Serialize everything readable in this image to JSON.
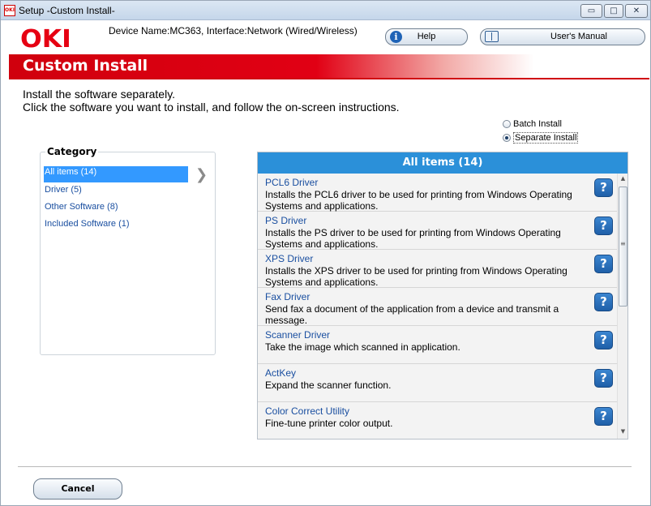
{
  "window": {
    "title": "Setup -Custom Install-",
    "icon_text": "OKI",
    "controls": {
      "minimize": "▭",
      "maximize": "□",
      "close": "✕"
    }
  },
  "header": {
    "logo": "OKI",
    "device_info": "Device Name:MC363, Interface:Network (Wired/Wireless)",
    "help_label": "Help",
    "manual_label": "User's Manual"
  },
  "banner": {
    "title": "Custom Install"
  },
  "instructions": {
    "line1": "Install the software separately.",
    "line2": "Click the software you want to install, and follow the on-screen instructions."
  },
  "install_mode": {
    "options": [
      "Batch Install",
      "Separate Install"
    ],
    "selected": "Separate Install"
  },
  "category": {
    "title": "Category",
    "items": [
      "All items (14)",
      "Driver (5)",
      "Other Software (8)",
      "Included Software (1)"
    ],
    "selected": "All items (14)",
    "arrow": "❯"
  },
  "items_panel": {
    "header": "All items (14)",
    "help_glyph": "?",
    "items": [
      {
        "name": "PCL6 Driver",
        "description": "Installs the PCL6 driver to be used for printing from Windows Operating Systems and applications."
      },
      {
        "name": "PS Driver",
        "description": "Installs the PS driver to be used for printing from Windows Operating Systems and applications."
      },
      {
        "name": "XPS Driver",
        "description": "Installs the XPS driver to be used for printing from Windows Operating Systems and applications."
      },
      {
        "name": "Fax Driver",
        "description": "Send fax a document of the application from a device and transmit a message."
      },
      {
        "name": "Scanner Driver",
        "description": "Take the image which scanned in application."
      },
      {
        "name": "ActKey",
        "description": "Expand the scanner function."
      },
      {
        "name": "Color Correct Utility",
        "description": "Fine-tune printer color output."
      }
    ]
  },
  "footer": {
    "cancel_label": "Cancel"
  },
  "colors": {
    "brand_red": "#e60012",
    "accent_blue": "#2b90d9",
    "selection_blue": "#3399ff",
    "link_blue": "#1a4fa0"
  }
}
